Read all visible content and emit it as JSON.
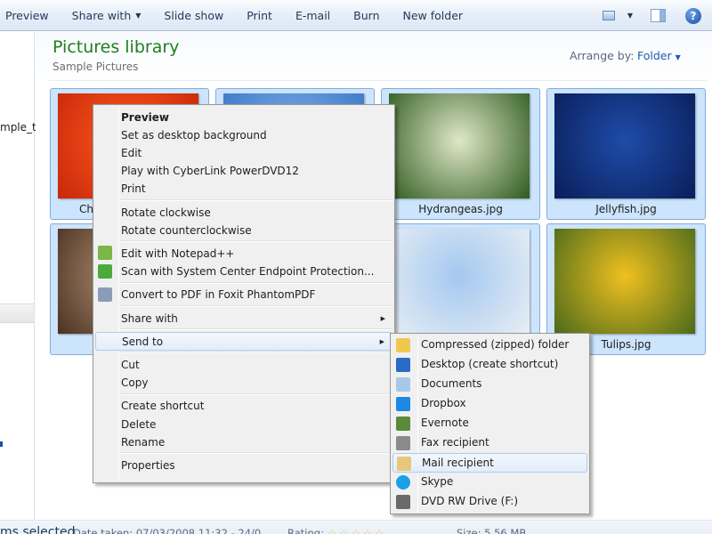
{
  "toolbar": {
    "items": [
      {
        "label": "Preview",
        "has_arrow": false
      },
      {
        "label": "Share with",
        "has_arrow": true
      },
      {
        "label": "Slide show",
        "has_arrow": false
      },
      {
        "label": "Print",
        "has_arrow": false
      },
      {
        "label": "E-mail",
        "has_arrow": false
      },
      {
        "label": "Burn",
        "has_arrow": false
      },
      {
        "label": "New folder",
        "has_arrow": false
      }
    ],
    "arrow_glyph": "▼",
    "help_glyph": "?"
  },
  "nav_pane": {
    "partial_text": "mple_th"
  },
  "library": {
    "title": "Pictures library",
    "subtitle": "Sample Pictures",
    "arrange_label": "Arrange by:",
    "arrange_value": "Folder"
  },
  "tiles": [
    {
      "label": "Chrysanthemum.jpg",
      "visible_label": "Ch",
      "colors": [
        "#ff5a1e",
        "#c8280a"
      ]
    },
    {
      "label": "",
      "colors": [
        "#7fb0e8",
        "#3d78c8"
      ]
    },
    {
      "label": "Hydrangeas.jpg",
      "colors": [
        "#dfe8c8",
        "#2e5a1e"
      ]
    },
    {
      "label": "Jellyfish.jpg",
      "colors": [
        "#1e4ca8",
        "#0a1e5a"
      ]
    },
    {
      "label": "",
      "colors": [
        "#b89678",
        "#4a3222"
      ]
    },
    {
      "label": "",
      "colors": [
        "#9ec4ec",
        "#4a6a8a"
      ]
    },
    {
      "label": "",
      "colors": [
        "#a4c8f0",
        "#e8eef4"
      ]
    },
    {
      "label": "Tulips.jpg",
      "colors": [
        "#f0c020",
        "#4a6a1a"
      ]
    }
  ],
  "context_menu": {
    "items": [
      {
        "label": "Preview",
        "bold": true
      },
      {
        "label": "Set as desktop background"
      },
      {
        "label": "Edit"
      },
      {
        "label": "Play with CyberLink PowerDVD12"
      },
      {
        "label": "Print"
      },
      {
        "separator": true
      },
      {
        "label": "Rotate clockwise"
      },
      {
        "label": "Rotate counterclockwise"
      },
      {
        "separator": true
      },
      {
        "label": "Edit with Notepad++",
        "icon": "notepad-plus-plus-icon",
        "icon_color": "#7ab648"
      },
      {
        "label": "Scan with System Center Endpoint Protection...",
        "icon": "endpoint-protection-icon",
        "icon_color": "#4caa3c"
      },
      {
        "separator": true
      },
      {
        "label": "Convert to PDF in Foxit PhantomPDF",
        "icon": "foxit-pdf-icon",
        "icon_color": "#8a9cb8"
      },
      {
        "separator": true
      },
      {
        "label": "Share with",
        "submenu": true
      },
      {
        "separator": true
      },
      {
        "label": "Send to",
        "submenu": true,
        "highlighted": true
      },
      {
        "separator": true
      },
      {
        "label": "Cut"
      },
      {
        "label": "Copy"
      },
      {
        "separator": true
      },
      {
        "label": "Create shortcut"
      },
      {
        "label": "Delete"
      },
      {
        "label": "Rename"
      },
      {
        "separator": true
      },
      {
        "label": "Properties"
      }
    ],
    "submenu_glyph": "▶"
  },
  "send_to_menu": {
    "items": [
      {
        "label": "Compressed (zipped) folder",
        "icon": "zip-folder-icon",
        "icon_color": "#f0c850"
      },
      {
        "label": "Desktop (create shortcut)",
        "icon": "desktop-icon",
        "icon_color": "#2a6ac8"
      },
      {
        "label": "Documents",
        "icon": "documents-icon",
        "icon_color": "#a8c8e8"
      },
      {
        "label": "Dropbox",
        "icon": "dropbox-icon",
        "icon_color": "#1e88e5"
      },
      {
        "label": "Evernote",
        "icon": "evernote-icon",
        "icon_color": "#5a8a3a"
      },
      {
        "label": "Fax recipient",
        "icon": "fax-icon",
        "icon_color": "#8a8a8a"
      },
      {
        "label": "Mail recipient",
        "icon": "mail-icon",
        "icon_color": "#e8c878",
        "highlighted": true
      },
      {
        "label": "Skype",
        "icon": "skype-icon",
        "icon_color": "#1aa0e8"
      },
      {
        "label": "DVD RW Drive (F:)",
        "icon": "dvd-drive-icon",
        "icon_color": "#6a6a6a"
      }
    ]
  },
  "status_bar": {
    "selection": "ms selected",
    "date_taken": "Date taken: 07/03/2008 11:32 - 24/0...",
    "rating_label": "Rating:",
    "rating_stars": "☆☆☆☆☆",
    "size": "Size: 5.56 MB"
  }
}
